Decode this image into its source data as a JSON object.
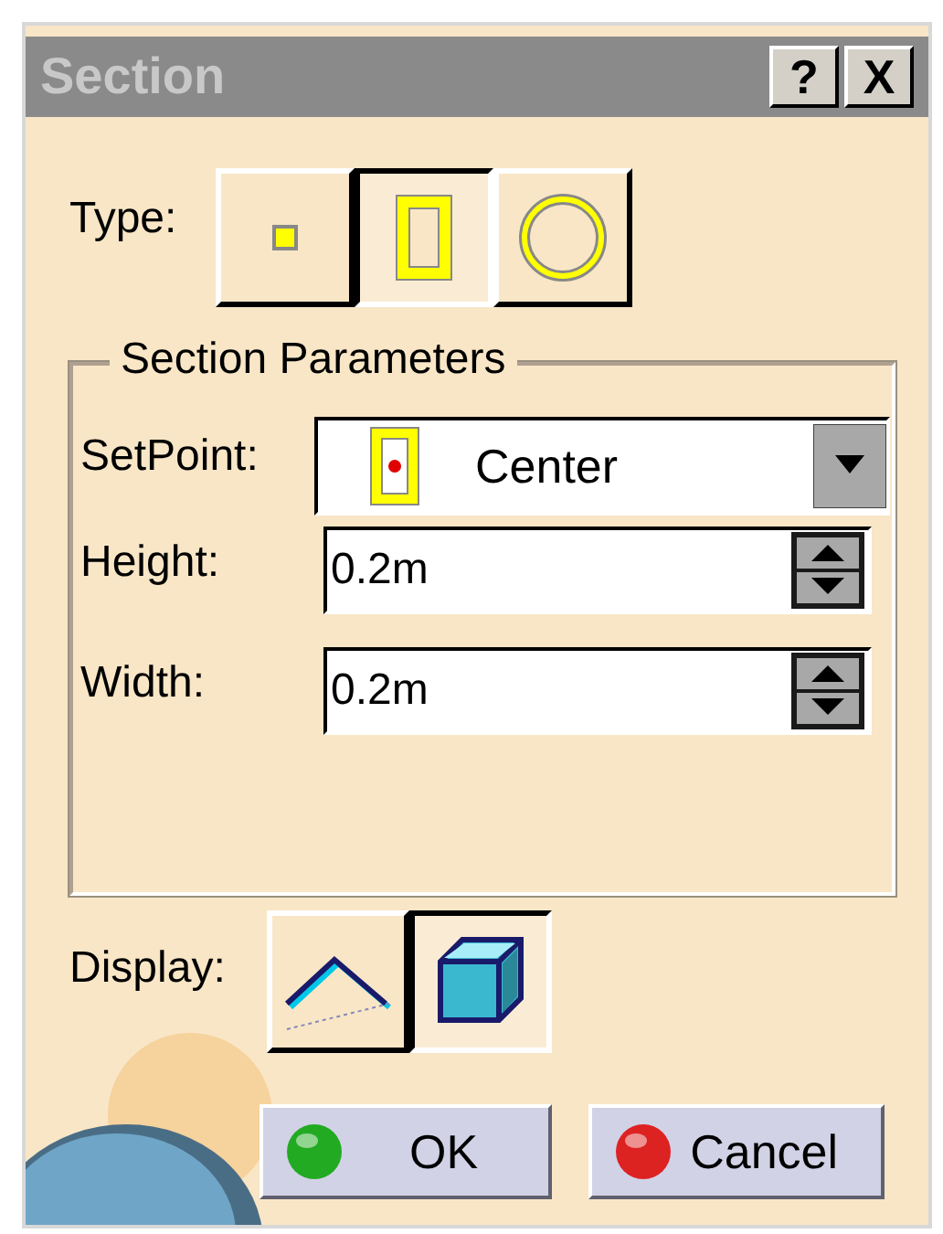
{
  "window": {
    "title": "Section",
    "help_button": "?",
    "close_button": "X"
  },
  "type": {
    "label": "Type:",
    "options": [
      {
        "kind": "point",
        "selected": false
      },
      {
        "kind": "rectangle",
        "selected": true
      },
      {
        "kind": "circle",
        "selected": false
      }
    ]
  },
  "section_parameters": {
    "title": "Section Parameters",
    "setpoint": {
      "label": "SetPoint:",
      "value": "Center"
    },
    "height": {
      "label": "Height:",
      "value": "0.2m"
    },
    "width": {
      "label": "Width:",
      "value": "0.2m"
    }
  },
  "display": {
    "label": "Display:",
    "options": [
      {
        "kind": "wireframe",
        "selected": false
      },
      {
        "kind": "solid",
        "selected": true
      }
    ]
  },
  "buttons": [
    {
      "kind": "ok",
      "label": "OK"
    },
    {
      "kind": "cancel",
      "label": "Cancel"
    }
  ]
}
